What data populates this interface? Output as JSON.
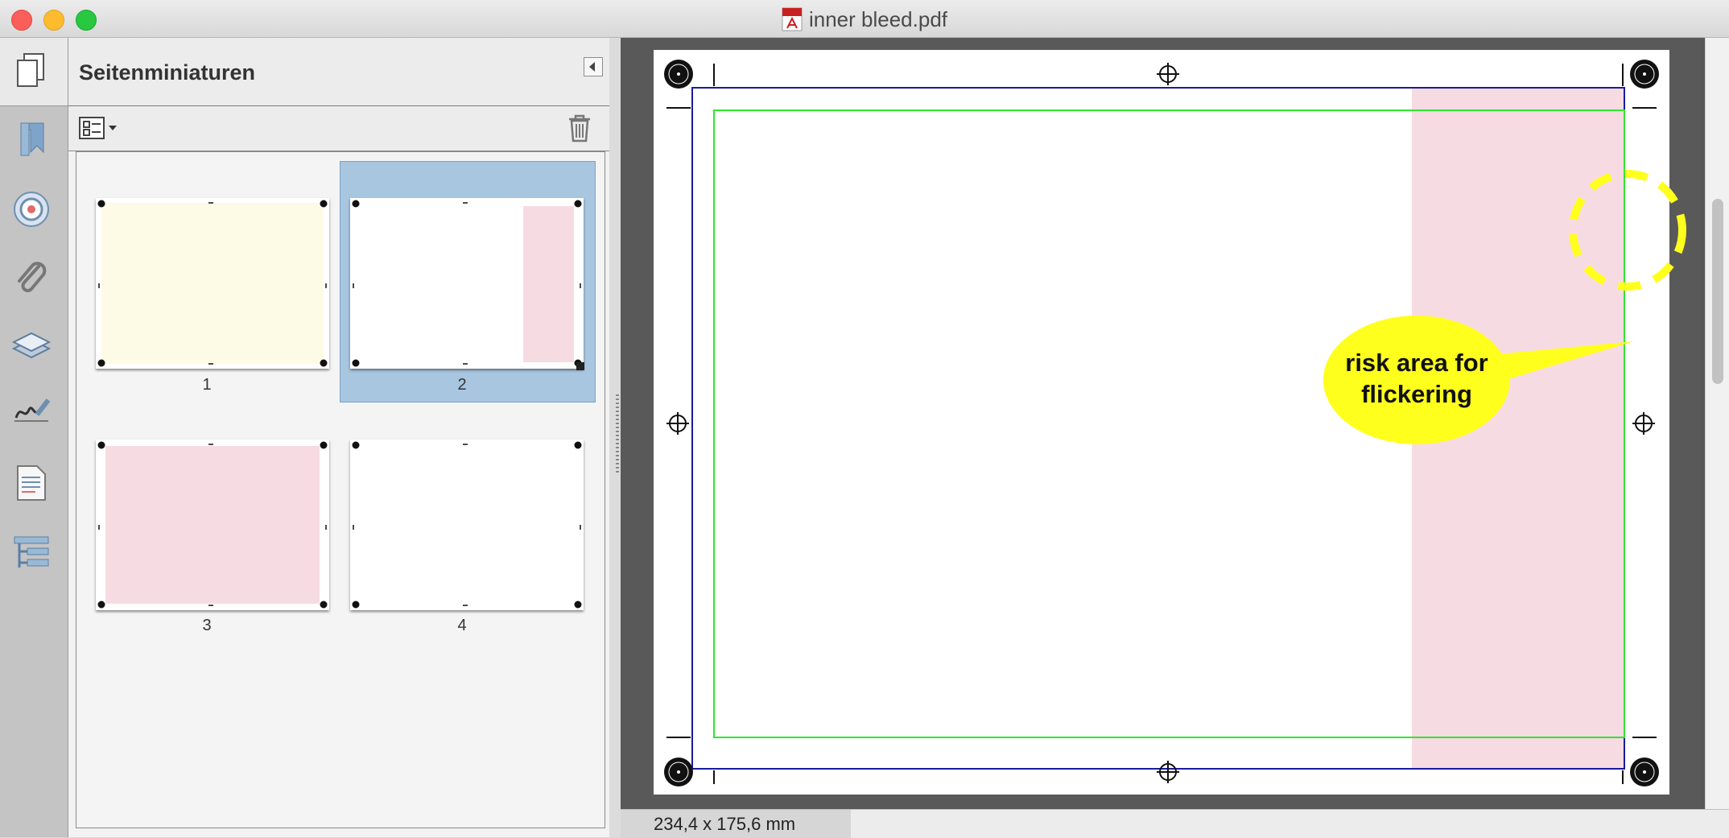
{
  "window": {
    "title": "inner bleed.pdf",
    "traffic_lights": [
      "close",
      "minimize",
      "zoom"
    ]
  },
  "sidebar": {
    "panel_title": "Seitenminiaturen",
    "tool_icons": [
      "page-thumbnails-icon",
      "bookmark-icon",
      "target-icon",
      "paperclip-icon",
      "layers-icon",
      "signature-icon",
      "document-icon",
      "tree-structure-icon"
    ]
  },
  "thumbnails": [
    {
      "label": "1",
      "fill": "#fdfbe6",
      "selected": false
    },
    {
      "label": "2",
      "fill": "#f7dbe3",
      "selected": true
    },
    {
      "label": "3",
      "fill": "#f7dbe3",
      "selected": false
    },
    {
      "label": "4",
      "fill": "#ffffff",
      "selected": false
    }
  ],
  "document": {
    "callout_line1": "risk area for",
    "callout_line2": "flickering",
    "trim_color": "#1a1aa0",
    "bleed_color": "#2ee82e",
    "risk_area_color": "#f7dbe3",
    "callout_color": "#ffff1e"
  },
  "status": {
    "page_size": "234,4 x 175,6 mm"
  }
}
